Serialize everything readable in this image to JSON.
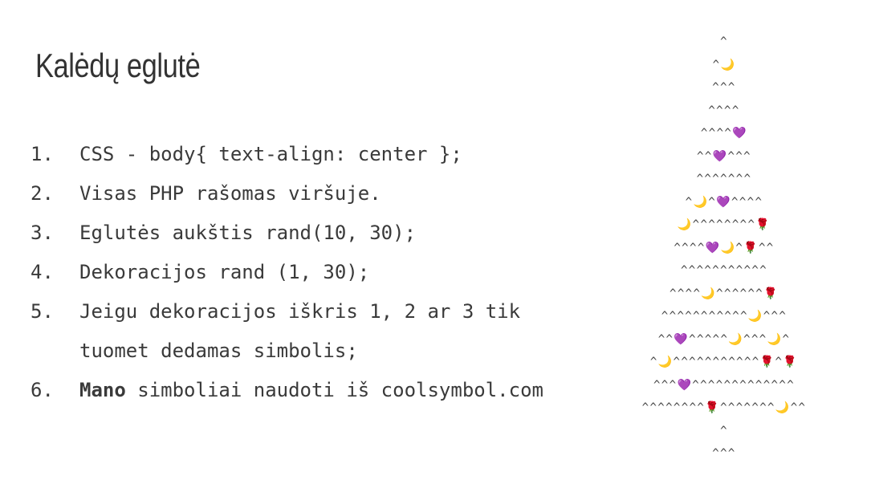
{
  "slide": {
    "title": "Kalėdų eglutė"
  },
  "steps": [
    {
      "num": "1.",
      "text": "CSS - body{ text-align: center };"
    },
    {
      "num": "2.",
      "text": "Visas PHP rašomas viršuje."
    },
    {
      "num": "3.",
      "text": "Eglutės aukštis rand(10, 30);"
    },
    {
      "num": "4.",
      "text": "Dekoracijos rand (1, 30);"
    },
    {
      "num": "5.",
      "text": "Jeigu dekoracijos iškris 1, 2 ar 3 tik tuomet dedamas simbolis;"
    },
    {
      "num": "6.",
      "bold": "Mano",
      "text": " simboliai naudoti iš coolsymbol.com"
    }
  ],
  "tree": {
    "rows": [
      "^",
      "^🌙",
      "^^^",
      "^^^^",
      "^^^^💜",
      "^^💜^^^",
      "^^^^^^^",
      "^🌙^💜^^^^",
      "🌙^^^^^^^^🌹",
      "^^^^💜🌙^🌹^^",
      "^^^^^^^^^^^",
      "^^^^🌙^^^^^^🌹",
      "^^^^^^^^^^^🌙^^^",
      "^^💜^^^^^🌙^^^🌙^",
      "^🌙^^^^^^^^^^^🌹^🌹",
      "^^^💜^^^^^^^^^^^^^",
      "^^^^^^^^🌹^^^^^^^🌙^^"
    ],
    "trunk": [
      "^",
      "^^^"
    ]
  }
}
